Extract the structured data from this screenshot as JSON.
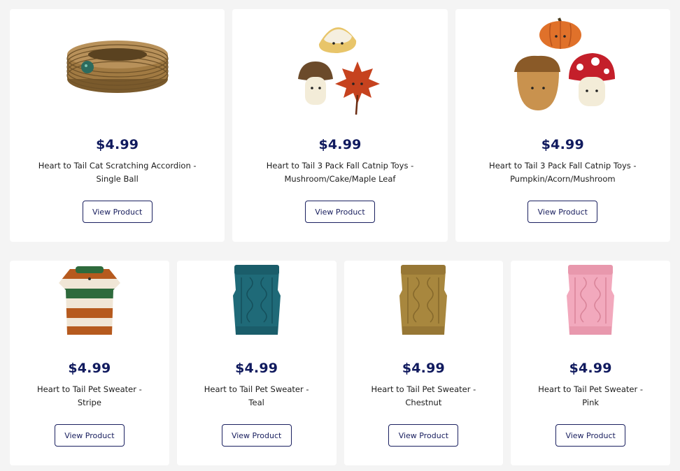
{
  "products_row_1": [
    {
      "image_icon": "cat-scratching-accordion-image",
      "price": "$4.99",
      "name": "Heart to Tail Cat Scratching Accordion - Single Ball",
      "button_label": "View Product"
    },
    {
      "image_icon": "fall-catnip-toys-mushroom-cake-maple-leaf-image",
      "price": "$4.99",
      "name": "Heart to Tail 3 Pack Fall Catnip Toys - Mushroom/Cake/Maple Leaf",
      "button_label": "View Product"
    },
    {
      "image_icon": "fall-catnip-toys-pumpkin-acorn-mushroom-image",
      "price": "$4.99",
      "name": "Heart to Tail 3 Pack Fall Catnip Toys - Pumpkin/Acorn/Mushroom",
      "button_label": "View Product"
    }
  ],
  "products_row_2": [
    {
      "image_icon": "stripe-sweater-image",
      "price": "$4.99",
      "name": "Heart to Tail Pet Sweater - Stripe",
      "button_label": "View Product"
    },
    {
      "image_icon": "teal-sweater-image",
      "price": "$4.99",
      "name": "Heart to Tail Pet Sweater - Teal",
      "button_label": "View Product"
    },
    {
      "image_icon": "chestnut-sweater-image",
      "price": "$4.99",
      "name": "Heart to Tail Pet Sweater - Chestnut",
      "button_label": "View Product"
    },
    {
      "image_icon": "pink-sweater-image",
      "price": "$4.99",
      "name": "Heart to Tail Pet Sweater - Pink",
      "button_label": "View Product"
    }
  ],
  "colors": {
    "price_text": "#101a5e",
    "button_border": "#1b2160",
    "page_background": "#f4f4f4",
    "card_background": "#ffffff"
  }
}
